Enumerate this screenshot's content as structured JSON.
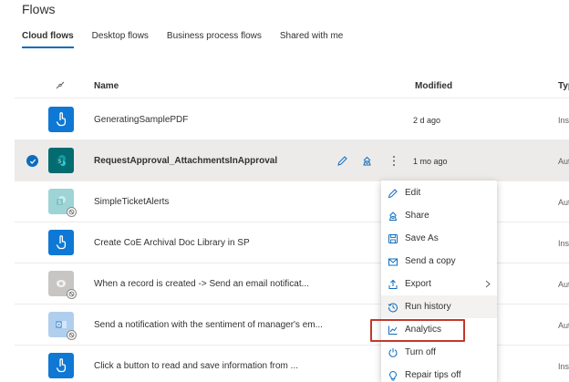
{
  "page": {
    "title": "Flows"
  },
  "tabs": [
    {
      "label": "Cloud flows",
      "active": true
    },
    {
      "label": "Desktop flows",
      "active": false
    },
    {
      "label": "Business process flows",
      "active": false
    },
    {
      "label": "Shared with me",
      "active": false
    }
  ],
  "table": {
    "headers": {
      "name": "Name",
      "modified": "Modified",
      "type": "Typ"
    },
    "rows": [
      {
        "name": "GeneratingSamplePDF",
        "modified": "2 d ago",
        "type": "Inst",
        "icon": "touch-icon",
        "color": "#0f78d4"
      },
      {
        "name": "RequestApproval_AttachmentsInApproval",
        "modified": "1 mo ago",
        "type": "Aut",
        "icon": "sharepoint-icon",
        "color": "#036c70",
        "selected": true
      },
      {
        "name": "SimpleTicketAlerts",
        "modified": "",
        "type": "Aut",
        "icon": "sharepoint-icon",
        "color": "#9fd4d6",
        "off": true
      },
      {
        "name": "Create CoE Archival Doc Library in SP",
        "modified": "",
        "type": "Inst",
        "icon": "touch-icon",
        "color": "#0f78d4"
      },
      {
        "name": "When a record is created -> Send an email notificat...",
        "modified": "",
        "type": "Aut",
        "icon": "dataverse-icon",
        "color": "#c8c6c4",
        "off": true
      },
      {
        "name": "Send a notification with the sentiment of manager's em...",
        "modified": "",
        "type": "Aut",
        "icon": "outlook-icon",
        "color": "#b0cfee",
        "off": true
      },
      {
        "name": "Click a button to read and save information from ...",
        "modified": "",
        "type": "Inst",
        "icon": "touch-icon",
        "color": "#0f78d4"
      }
    ]
  },
  "context_menu": {
    "items": [
      {
        "label": "Edit",
        "icon": "pencil-icon"
      },
      {
        "label": "Share",
        "icon": "share-icon"
      },
      {
        "label": "Save As",
        "icon": "save-icon"
      },
      {
        "label": "Send a copy",
        "icon": "send-icon"
      },
      {
        "label": "Export",
        "icon": "export-icon",
        "submenu": true
      },
      {
        "label": "Run history",
        "icon": "history-icon",
        "hover": true
      },
      {
        "label": "Analytics",
        "icon": "analytics-icon",
        "highlighted": true
      },
      {
        "label": "Turn off",
        "icon": "power-icon"
      },
      {
        "label": "Repair tips off",
        "icon": "lightbulb-icon"
      }
    ]
  },
  "colors": {
    "accent": "#0f6cbd",
    "highlight_border": "#c0392b"
  }
}
